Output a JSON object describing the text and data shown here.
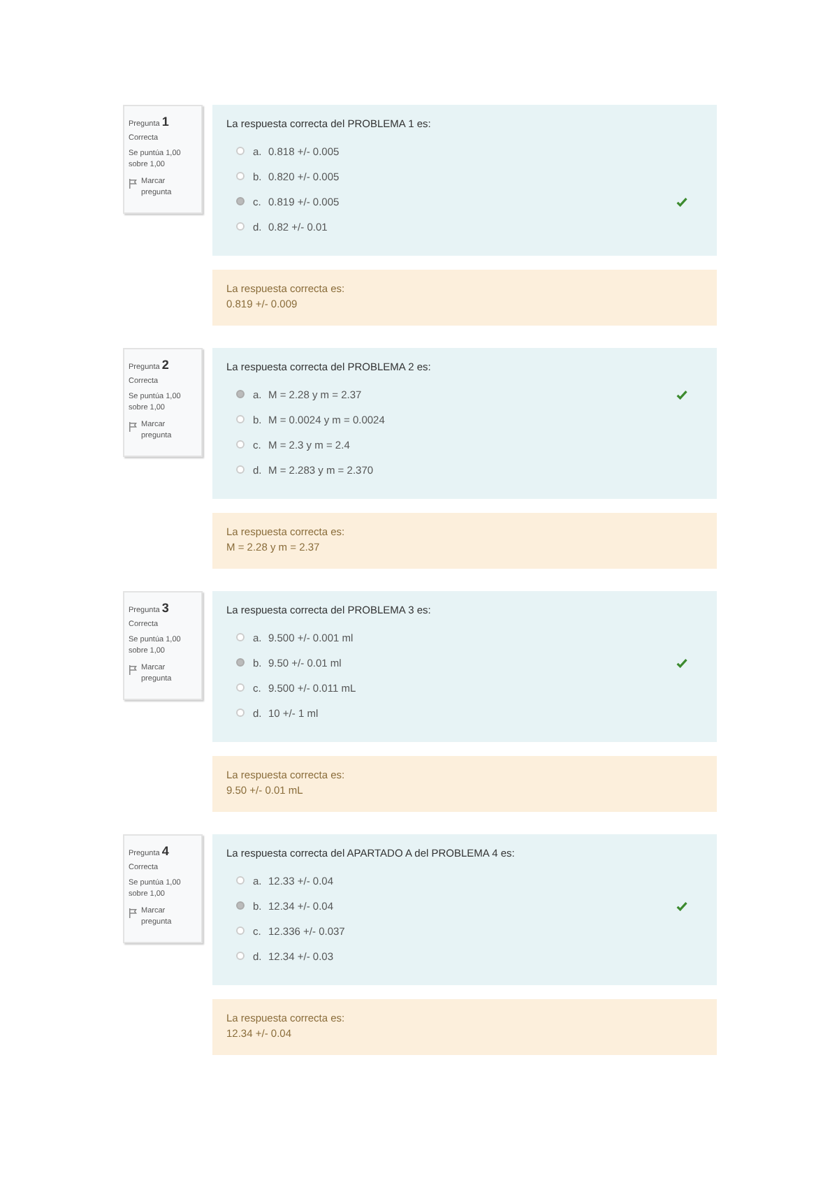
{
  "questions": [
    {
      "label": "Pregunta",
      "number": "1",
      "state": "Correcta",
      "score": "Se puntúa 1,00 sobre 1,00",
      "flag": "Marcar pregunta",
      "text": "La respuesta correcta del PROBLEMA 1 es:",
      "options": [
        {
          "letter": "a.",
          "text": "0.818 +/- 0.005",
          "selected": false,
          "correct": false
        },
        {
          "letter": "b.",
          "text": "0.820 +/- 0.005",
          "selected": false,
          "correct": false
        },
        {
          "letter": "c.",
          "text": "0.819 +/- 0.005",
          "selected": true,
          "correct": true
        },
        {
          "letter": "d.",
          "text": "0.82 +/- 0.01",
          "selected": false,
          "correct": false
        }
      ],
      "feedback_label": "La respuesta correcta es:",
      "feedback_answer": "0.819 +/- 0.009"
    },
    {
      "label": "Pregunta",
      "number": "2",
      "state": "Correcta",
      "score": "Se puntúa 1,00 sobre 1,00",
      "flag": "Marcar pregunta",
      "text": "La respuesta correcta del PROBLEMA 2 es:",
      "options": [
        {
          "letter": "a.",
          "text": "M = 2.28 y m = 2.37",
          "selected": true,
          "correct": true
        },
        {
          "letter": "b.",
          "text": "M = 0.0024 y m = 0.0024",
          "selected": false,
          "correct": false
        },
        {
          "letter": "c.",
          "text": "M = 2.3 y m = 2.4",
          "selected": false,
          "correct": false
        },
        {
          "letter": "d.",
          "text": "M = 2.283 y m = 2.370",
          "selected": false,
          "correct": false
        }
      ],
      "feedback_label": "La respuesta correcta es:",
      "feedback_answer": "M = 2.28 y m = 2.37"
    },
    {
      "label": "Pregunta",
      "number": "3",
      "state": "Correcta",
      "score": "Se puntúa 1,00 sobre 1,00",
      "flag": "Marcar pregunta",
      "text": "La respuesta correcta del PROBLEMA 3 es:",
      "options": [
        {
          "letter": "a.",
          "text": "9.500 +/- 0.001 ml",
          "selected": false,
          "correct": false
        },
        {
          "letter": "b.",
          "text": "9.50 +/- 0.01 ml",
          "selected": true,
          "correct": true
        },
        {
          "letter": "c.",
          "text": "9.500 +/- 0.011 mL",
          "selected": false,
          "correct": false
        },
        {
          "letter": "d.",
          "text": "10 +/- 1 ml",
          "selected": false,
          "correct": false
        }
      ],
      "feedback_label": "La respuesta correcta es:",
      "feedback_answer": "9.50 +/- 0.01 mL"
    },
    {
      "label": "Pregunta",
      "number": "4",
      "state": "Correcta",
      "score": "Se puntúa 1,00 sobre 1,00",
      "flag": "Marcar pregunta",
      "text": "La respuesta correcta del APARTADO A del PROBLEMA 4 es:",
      "options": [
        {
          "letter": "a.",
          "text": "12.33 +/- 0.04",
          "selected": false,
          "correct": false
        },
        {
          "letter": "b.",
          "text": "12.34 +/- 0.04",
          "selected": true,
          "correct": true
        },
        {
          "letter": "c.",
          "text": "12.336 +/- 0.037",
          "selected": false,
          "correct": false
        },
        {
          "letter": "d.",
          "text": "12.34 +/- 0.03",
          "selected": false,
          "correct": false
        }
      ],
      "feedback_label": "La respuesta correcta es:",
      "feedback_answer": "12.34 +/- 0.04"
    }
  ]
}
